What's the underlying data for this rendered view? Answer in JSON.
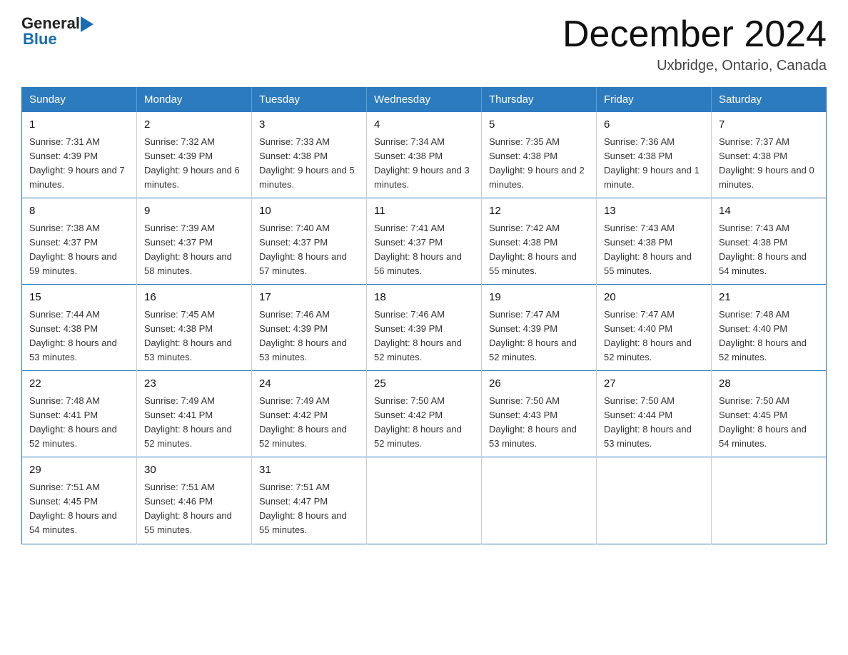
{
  "header": {
    "logo_general": "General",
    "logo_blue": "Blue",
    "title": "December 2024",
    "subtitle": "Uxbridge, Ontario, Canada"
  },
  "days_of_week": [
    "Sunday",
    "Monday",
    "Tuesday",
    "Wednesday",
    "Thursday",
    "Friday",
    "Saturday"
  ],
  "weeks": [
    [
      {
        "day": "1",
        "sunrise": "7:31 AM",
        "sunset": "4:39 PM",
        "daylight": "9 hours and 7 minutes."
      },
      {
        "day": "2",
        "sunrise": "7:32 AM",
        "sunset": "4:39 PM",
        "daylight": "9 hours and 6 minutes."
      },
      {
        "day": "3",
        "sunrise": "7:33 AM",
        "sunset": "4:38 PM",
        "daylight": "9 hours and 5 minutes."
      },
      {
        "day": "4",
        "sunrise": "7:34 AM",
        "sunset": "4:38 PM",
        "daylight": "9 hours and 3 minutes."
      },
      {
        "day": "5",
        "sunrise": "7:35 AM",
        "sunset": "4:38 PM",
        "daylight": "9 hours and 2 minutes."
      },
      {
        "day": "6",
        "sunrise": "7:36 AM",
        "sunset": "4:38 PM",
        "daylight": "9 hours and 1 minute."
      },
      {
        "day": "7",
        "sunrise": "7:37 AM",
        "sunset": "4:38 PM",
        "daylight": "9 hours and 0 minutes."
      }
    ],
    [
      {
        "day": "8",
        "sunrise": "7:38 AM",
        "sunset": "4:37 PM",
        "daylight": "8 hours and 59 minutes."
      },
      {
        "day": "9",
        "sunrise": "7:39 AM",
        "sunset": "4:37 PM",
        "daylight": "8 hours and 58 minutes."
      },
      {
        "day": "10",
        "sunrise": "7:40 AM",
        "sunset": "4:37 PM",
        "daylight": "8 hours and 57 minutes."
      },
      {
        "day": "11",
        "sunrise": "7:41 AM",
        "sunset": "4:37 PM",
        "daylight": "8 hours and 56 minutes."
      },
      {
        "day": "12",
        "sunrise": "7:42 AM",
        "sunset": "4:38 PM",
        "daylight": "8 hours and 55 minutes."
      },
      {
        "day": "13",
        "sunrise": "7:43 AM",
        "sunset": "4:38 PM",
        "daylight": "8 hours and 55 minutes."
      },
      {
        "day": "14",
        "sunrise": "7:43 AM",
        "sunset": "4:38 PM",
        "daylight": "8 hours and 54 minutes."
      }
    ],
    [
      {
        "day": "15",
        "sunrise": "7:44 AM",
        "sunset": "4:38 PM",
        "daylight": "8 hours and 53 minutes."
      },
      {
        "day": "16",
        "sunrise": "7:45 AM",
        "sunset": "4:38 PM",
        "daylight": "8 hours and 53 minutes."
      },
      {
        "day": "17",
        "sunrise": "7:46 AM",
        "sunset": "4:39 PM",
        "daylight": "8 hours and 53 minutes."
      },
      {
        "day": "18",
        "sunrise": "7:46 AM",
        "sunset": "4:39 PM",
        "daylight": "8 hours and 52 minutes."
      },
      {
        "day": "19",
        "sunrise": "7:47 AM",
        "sunset": "4:39 PM",
        "daylight": "8 hours and 52 minutes."
      },
      {
        "day": "20",
        "sunrise": "7:47 AM",
        "sunset": "4:40 PM",
        "daylight": "8 hours and 52 minutes."
      },
      {
        "day": "21",
        "sunrise": "7:48 AM",
        "sunset": "4:40 PM",
        "daylight": "8 hours and 52 minutes."
      }
    ],
    [
      {
        "day": "22",
        "sunrise": "7:48 AM",
        "sunset": "4:41 PM",
        "daylight": "8 hours and 52 minutes."
      },
      {
        "day": "23",
        "sunrise": "7:49 AM",
        "sunset": "4:41 PM",
        "daylight": "8 hours and 52 minutes."
      },
      {
        "day": "24",
        "sunrise": "7:49 AM",
        "sunset": "4:42 PM",
        "daylight": "8 hours and 52 minutes."
      },
      {
        "day": "25",
        "sunrise": "7:50 AM",
        "sunset": "4:42 PM",
        "daylight": "8 hours and 52 minutes."
      },
      {
        "day": "26",
        "sunrise": "7:50 AM",
        "sunset": "4:43 PM",
        "daylight": "8 hours and 53 minutes."
      },
      {
        "day": "27",
        "sunrise": "7:50 AM",
        "sunset": "4:44 PM",
        "daylight": "8 hours and 53 minutes."
      },
      {
        "day": "28",
        "sunrise": "7:50 AM",
        "sunset": "4:45 PM",
        "daylight": "8 hours and 54 minutes."
      }
    ],
    [
      {
        "day": "29",
        "sunrise": "7:51 AM",
        "sunset": "4:45 PM",
        "daylight": "8 hours and 54 minutes."
      },
      {
        "day": "30",
        "sunrise": "7:51 AM",
        "sunset": "4:46 PM",
        "daylight": "8 hours and 55 minutes."
      },
      {
        "day": "31",
        "sunrise": "7:51 AM",
        "sunset": "4:47 PM",
        "daylight": "8 hours and 55 minutes."
      },
      null,
      null,
      null,
      null
    ]
  ],
  "labels": {
    "sunrise": "Sunrise:",
    "sunset": "Sunset:",
    "daylight": "Daylight:"
  }
}
